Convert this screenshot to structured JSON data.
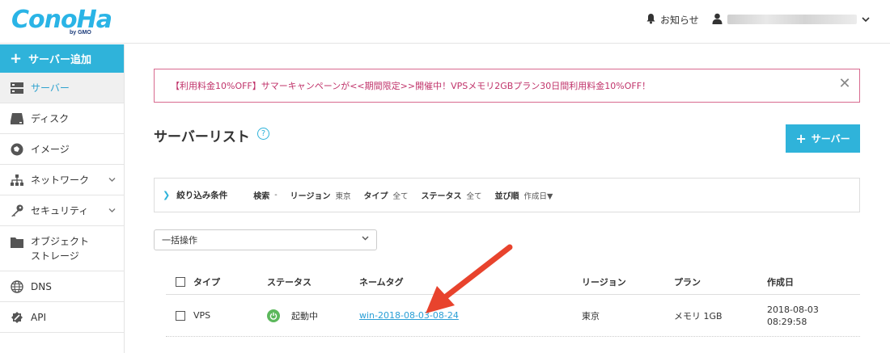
{
  "header": {
    "logo": "ConoHa",
    "logo_sub": "by GMO",
    "notice_label": "お知らせ"
  },
  "sidebar": {
    "add_label": "サーバー追加",
    "items": [
      {
        "label": "サーバー",
        "icon": "server-icon",
        "active": true
      },
      {
        "label": "ディスク",
        "icon": "disk-icon"
      },
      {
        "label": "イメージ",
        "icon": "image-icon"
      },
      {
        "label": "ネットワーク",
        "icon": "network-icon",
        "chevron": true
      },
      {
        "label": "セキュリティ",
        "icon": "key-icon",
        "chevron": true
      },
      {
        "label_1": "オブジェクト",
        "label_2": "ストレージ",
        "icon": "folder-icon"
      },
      {
        "label": "DNS",
        "icon": "globe-icon"
      },
      {
        "label": "API",
        "icon": "api-icon"
      }
    ]
  },
  "banner": {
    "text": "【利用料金10%OFF】サマーキャンペーンが<<期間限定>>開催中！VPSメモリ2GBプラン30日間利用料金10%OFF！",
    "close": "✕"
  },
  "page": {
    "title": "サーバーリスト",
    "help": "?",
    "add_button": "サーバー"
  },
  "filter": {
    "title": "絞り込み条件",
    "search_label": "検索",
    "search_value": "-",
    "region_label": "リージョン",
    "region_value": "東京",
    "type_label": "タイプ",
    "type_value": "全て",
    "status_label": "ステータス",
    "status_value": "全て",
    "sort_label": "並び順",
    "sort_value": "作成日▼"
  },
  "bulk": {
    "label": "一括操作"
  },
  "table": {
    "headers": {
      "type": "タイプ",
      "status": "ステータス",
      "nametag": "ネームタグ",
      "region": "リージョン",
      "plan": "プラン",
      "created": "作成日"
    },
    "rows": [
      {
        "type": "VPS",
        "status": "起動中",
        "nametag": "win-2018-08-03-08-24",
        "region": "東京",
        "plan": "メモリ 1GB",
        "created_date": "2018-08-03",
        "created_time": "08:29:58"
      }
    ]
  },
  "colors": {
    "accent": "#2fb3da",
    "banner_border": "#d86a8f",
    "banner_text": "#c0336a",
    "status_running": "#5cb85c",
    "arrow": "#e8432d"
  }
}
